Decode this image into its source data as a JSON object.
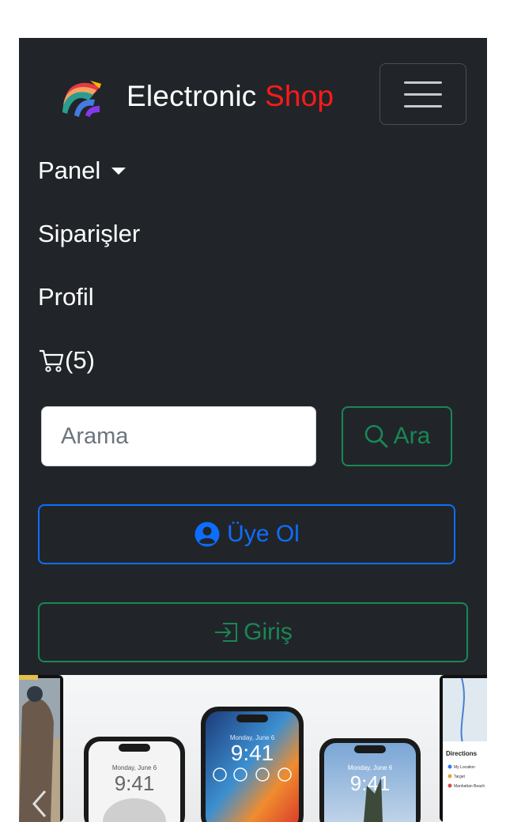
{
  "brand": {
    "name_main": "Electronic",
    "name_accent": "Shop",
    "accent_color": "#ff1a1a"
  },
  "nav": {
    "items": [
      {
        "label": "Panel",
        "has_dropdown": true
      },
      {
        "label": "Siparişler"
      },
      {
        "label": "Profil"
      }
    ],
    "cart": {
      "icon": "cart-icon",
      "count_text": "(5)"
    }
  },
  "search": {
    "placeholder": "Arama",
    "value": "",
    "button_label": "Ara",
    "button_icon": "search-icon"
  },
  "auth": {
    "signup_label": "Üye Ol",
    "signup_icon": "person-circle-icon",
    "login_label": "Giriş",
    "login_icon": "box-arrow-in-right-icon"
  },
  "carousel": {
    "slide_times": [
      "9:41",
      "9:41",
      "9:41"
    ],
    "slide_date": "Monday, June 6",
    "map_heading": "Directions",
    "map_rows": [
      "My Location",
      "Target",
      "Manhattan Beach"
    ]
  },
  "colors": {
    "navbar_bg": "#212529",
    "success": "#198754",
    "primary": "#0d6efd"
  }
}
